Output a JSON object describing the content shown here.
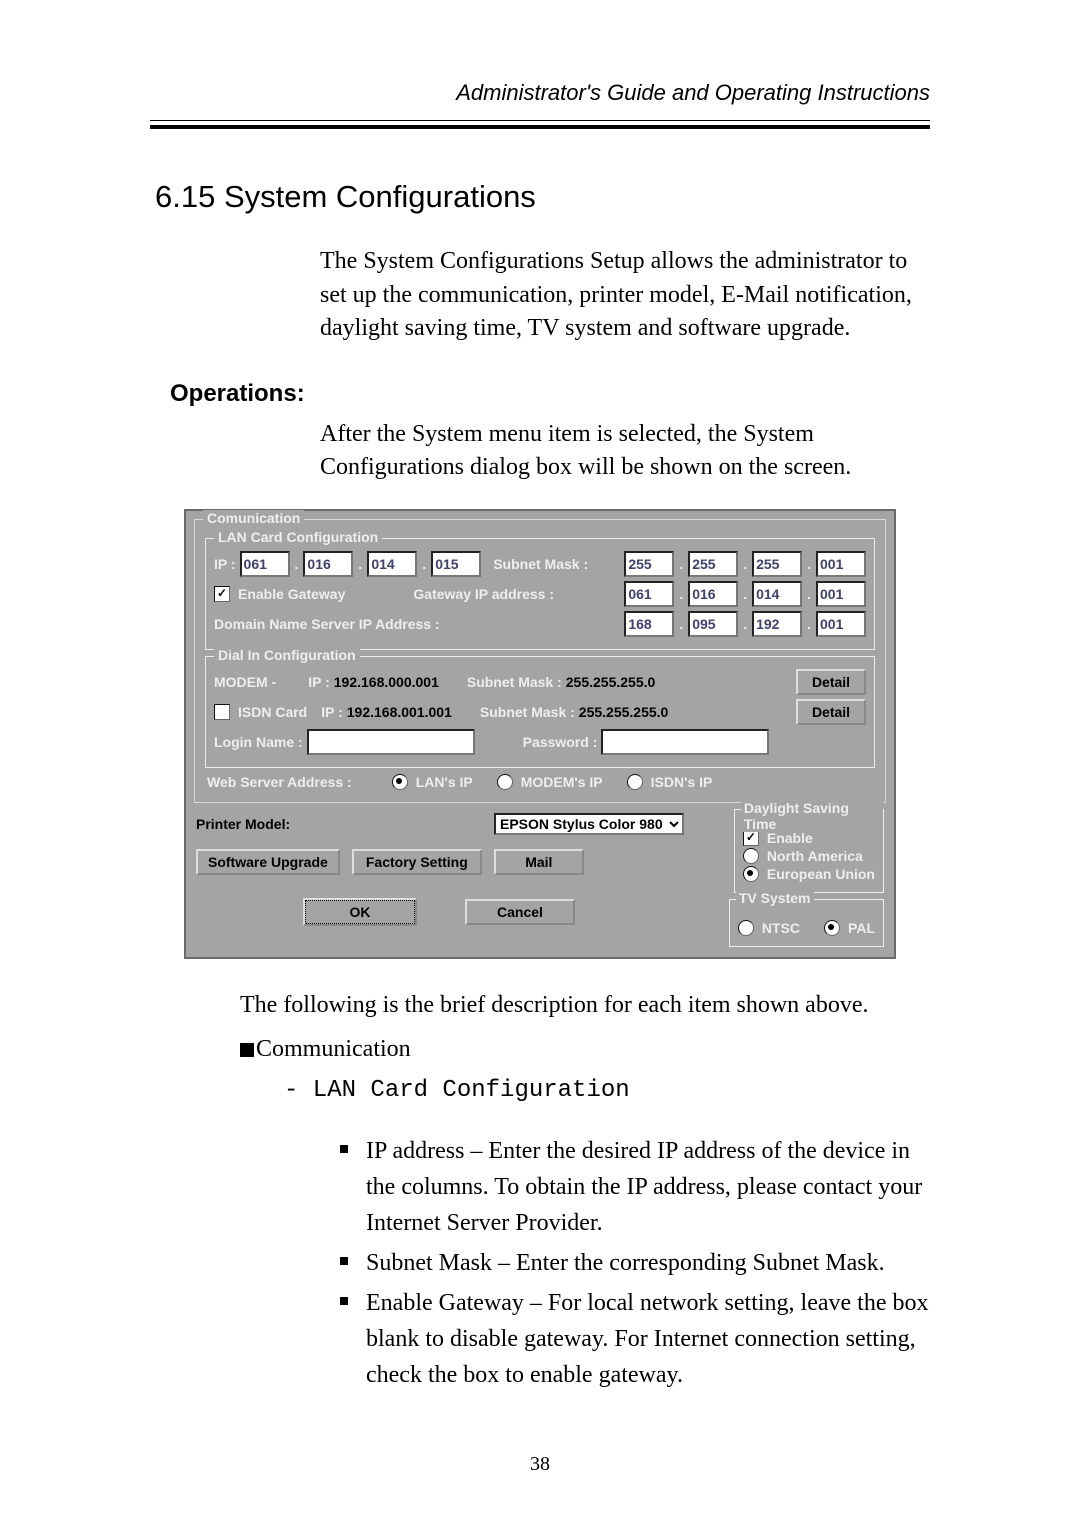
{
  "header": "Administrator's Guide and Operating Instructions",
  "section_title": "6.15 System Configurations",
  "intro_para": "The System Configurations Setup allows the administrator to set up the communication, printer model, E-Mail notification, daylight saving time, TV system and software upgrade.",
  "ops_heading": "Operations:",
  "ops_para": "After the System menu item is selected, the System Configurations dialog box will be shown on the screen.",
  "dialog": {
    "comm": "Comunication",
    "lan_grp": "LAN Card Configuration",
    "ip_lbl": "IP :",
    "ip": [
      "061",
      "016",
      "014",
      "015"
    ],
    "subnet_lbl": "Subnet Mask :",
    "subnet": [
      "255",
      "255",
      "255",
      "001"
    ],
    "enable_gw": "Enable Gateway",
    "gw_lbl": "Gateway IP address :",
    "gw": [
      "061",
      "016",
      "014",
      "001"
    ],
    "dns_lbl": "Domain Name Server IP  Address :",
    "dns": [
      "168",
      "095",
      "192",
      "001"
    ],
    "dial_grp": "Dial In Configuration",
    "modem_lbl": "MODEM -",
    "modem_ip_lbl": "IP :",
    "modem_ip": "192.168.000.001",
    "modem_sm_lbl": "Subnet Mask :",
    "modem_sm": "255.255.255.0",
    "isdn_lbl": "ISDN Card",
    "isdn_ip_lbl": "IP :",
    "isdn_ip": "192.168.001.001",
    "isdn_sm_lbl": "Subnet Mask :",
    "isdn_sm": "255.255.255.0",
    "detail": "Detail",
    "login_lbl": "Login Name :",
    "pwd_lbl": "Password :",
    "web_lbl": "Web Server Address :",
    "web_lan": "LAN's IP",
    "web_modem": "MODEM's IP",
    "web_isdn": "ISDN's IP",
    "printer_lbl": "Printer Model:",
    "printer_val": "EPSON Stylus Color 980",
    "sw_upg": "Software Upgrade",
    "factory": "Factory Setting",
    "mail": "Mail",
    "dst_grp": "Daylight Saving Time",
    "dst_enable": "Enable",
    "dst_na": "North America",
    "dst_eu": "European Union",
    "tv_grp": "TV System",
    "tv_ntsc": "NTSC",
    "tv_pal": "PAL",
    "ok": "OK",
    "cancel": "Cancel"
  },
  "post_para": "The following is the brief description for each item shown above.",
  "comm_hdr": "Communication",
  "lan_cfg_hdr": "- LAN Card Configuration",
  "bullets": [
    "IP address – Enter the desired IP address of the device in the columns. To obtain the IP address, please contact your Internet Server Provider.",
    "Subnet Mask – Enter the corresponding Subnet Mask.",
    "Enable Gateway – For local network setting, leave the box blank to disable gateway. For Internet connection setting, check the box to enable gateway."
  ],
  "pagenum": "38"
}
